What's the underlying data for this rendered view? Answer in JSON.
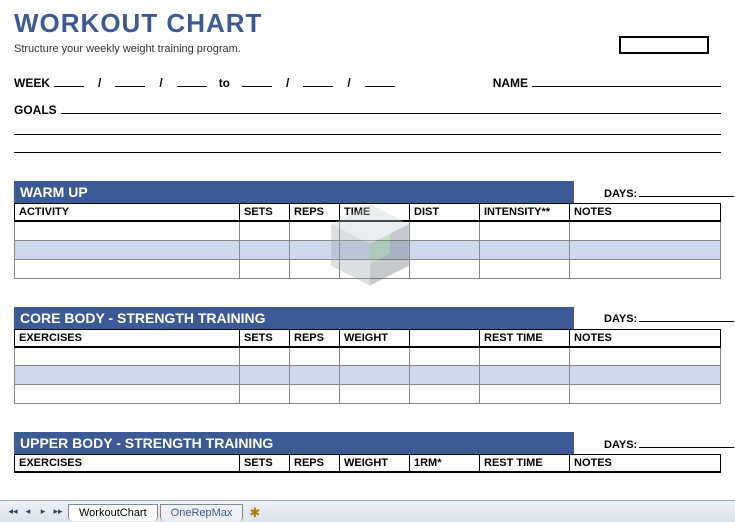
{
  "title": "WORKOUT CHART",
  "subtitle": "Structure your weekly weight training program.",
  "header": {
    "week_label": "WEEK",
    "to_label": "to",
    "name_label": "NAME",
    "goals_label": "GOALS"
  },
  "days_label": "DAYS:",
  "sections": {
    "warmup": {
      "title": "WARM UP",
      "cols": [
        "ACTIVITY",
        "SETS",
        "REPS",
        "TIME",
        "DIST",
        "INTENSITY**",
        "NOTES"
      ]
    },
    "core": {
      "title": "CORE BODY - STRENGTH TRAINING",
      "cols": [
        "EXERCISES",
        "SETS",
        "REPS",
        "WEIGHT",
        "",
        "REST TIME",
        "NOTES"
      ]
    },
    "upper": {
      "title": "UPPER BODY - STRENGTH TRAINING",
      "cols": [
        "EXERCISES",
        "SETS",
        "REPS",
        "WEIGHT",
        "1RM*",
        "REST TIME",
        "NOTES"
      ]
    }
  },
  "tabs": {
    "active": "WorkoutChart",
    "second": "OneRepMax"
  }
}
